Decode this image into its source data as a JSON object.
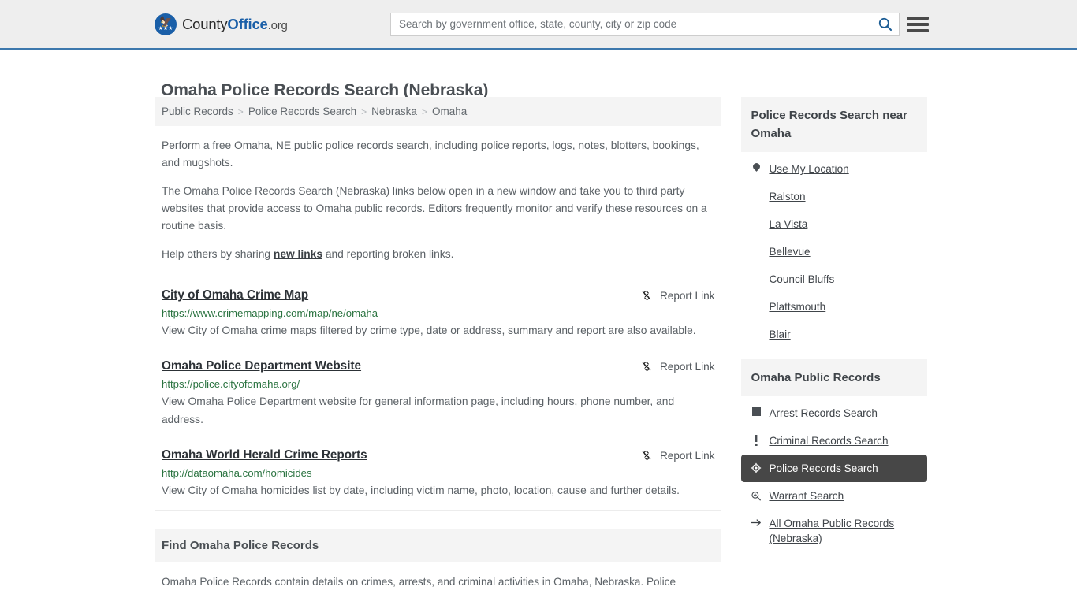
{
  "header": {
    "brand": {
      "part1": "County",
      "part2": "Office",
      "part3": ".org"
    },
    "search": {
      "placeholder": "Search by government office, state, county, city or zip code",
      "value": "",
      "button_name": "search-icon"
    },
    "menu_name": "hamburger-menu-icon",
    "accent_color": "#3d78ad"
  },
  "page": {
    "title": "Omaha Police Records Search (Nebraska)"
  },
  "breadcrumb": {
    "items": [
      {
        "label": "Public Records"
      },
      {
        "label": "Police Records Search"
      },
      {
        "label": "Nebraska"
      },
      {
        "label": "Omaha"
      }
    ],
    "separator": ">"
  },
  "intro": {
    "p1": "Perform a free Omaha, NE public police records search, including police reports, logs, notes, blotters, bookings, and mugshots.",
    "p2": "The Omaha Police Records Search (Nebraska) links below open in a new window and take you to third party websites that provide access to Omaha public records. Editors frequently monitor and verify these resources on a routine basis.",
    "p3_before": "Help others by sharing ",
    "p3_link": "new links",
    "p3_after": " and reporting broken links."
  },
  "results": {
    "report_label": "Report Link",
    "report_icon": "broken-link-icon",
    "items": [
      {
        "title": "City of Omaha Crime Map",
        "url": "https://www.crimemapping.com/map/ne/omaha",
        "description": "View City of Omaha crime maps filtered by crime type, date or address, summary and report are also available."
      },
      {
        "title": "Omaha Police Department Website",
        "url": "https://police.cityofomaha.org/",
        "description": "View Omaha Police Department website for general information page, including hours, phone number, and address."
      },
      {
        "title": "Omaha World Herald Crime Reports",
        "url": "http://dataomaha.com/homicides",
        "description": "View City of Omaha homicides list by date, including victim name, photo, location, cause and further details."
      }
    ]
  },
  "find_section": {
    "heading": "Find Omaha Police Records",
    "body": "Omaha Police Records contain details on crimes, arrests, and criminal activities in Omaha, Nebraska. Police"
  },
  "sidebar": {
    "nearby": {
      "heading": "Police Records Search near Omaha",
      "items": [
        {
          "label": "Use My Location",
          "icon": "map-pin-icon"
        },
        {
          "label": "Ralston",
          "icon": ""
        },
        {
          "label": "La Vista",
          "icon": ""
        },
        {
          "label": "Bellevue",
          "icon": ""
        },
        {
          "label": "Council Bluffs",
          "icon": ""
        },
        {
          "label": "Plattsmouth",
          "icon": ""
        },
        {
          "label": "Blair",
          "icon": ""
        }
      ]
    },
    "public_records": {
      "heading": "Omaha Public Records",
      "items": [
        {
          "label": "Arrest Records Search",
          "icon": "square-icon",
          "active": false
        },
        {
          "label": "Criminal Records Search",
          "icon": "exclamation-icon",
          "active": false
        },
        {
          "label": "Police Records Search",
          "icon": "police-badge-icon",
          "active": true
        },
        {
          "label": "Warrant Search",
          "icon": "magnifier-plus-icon",
          "active": false
        },
        {
          "label": "All Omaha Public Records (Nebraska)",
          "icon": "arrow-right-icon",
          "active": false
        }
      ]
    }
  }
}
